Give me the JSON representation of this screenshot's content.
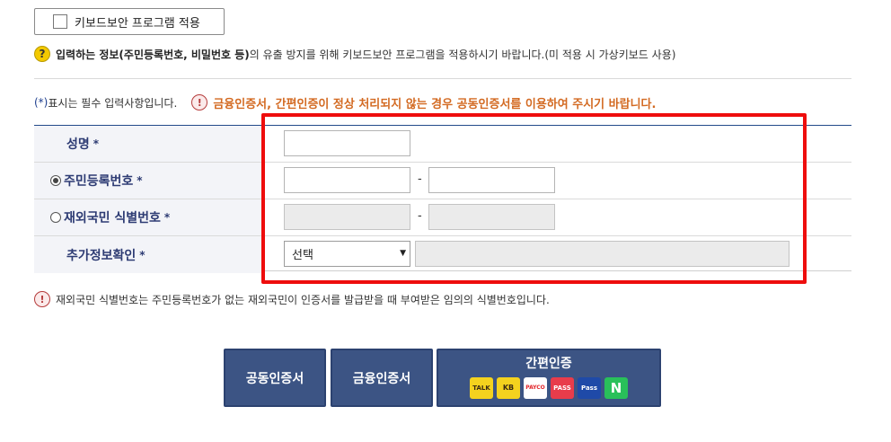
{
  "keyboard_security": {
    "label": "키보드보안 프로그램 적용",
    "checked": false
  },
  "notice": {
    "icon": "?",
    "bold_text": "입력하는 정보(주민등록번호, 비밀번호 등)",
    "rest_text": "의 유출 방지를 위해 키보드보안 프로그램을 적용하시기 바랍니다.(미 적용 시 가상키보드 사용)"
  },
  "required_note": {
    "star": "(*)",
    "text": " 표시는 필수 입력사항입니다."
  },
  "warning": {
    "icon": "!",
    "text": "금융인증서, 간편인증이 정상 처리되지 않는 경우 공동인증서를 이용하여 주시기 바랍니다."
  },
  "form": {
    "name": {
      "label": "성명",
      "star": "*",
      "value": ""
    },
    "resident": {
      "label": "주민등록번호",
      "star": "*",
      "selected": true,
      "dash": "-",
      "front": "",
      "back": ""
    },
    "foreign": {
      "label": "재외국민 식별번호",
      "star": "*",
      "selected": false,
      "dash": "-",
      "front": "",
      "back": ""
    },
    "extra": {
      "label": "추가정보확인",
      "star": "*",
      "select_value": "선택",
      "select_arrow": "▼",
      "value": ""
    }
  },
  "footnote": {
    "icon": "!",
    "text": "재외국민 식별번호는 주민등록번호가 없는 재외국민이 인증서를 발급받을 때 부여받은 임의의 식별번호입니다."
  },
  "buttons": {
    "joint_cert": "공동인증서",
    "financial_cert": "금융인증서",
    "simple_auth": "간편인증",
    "providers": [
      {
        "name": "kakao-icon",
        "label": "TALK"
      },
      {
        "name": "kb-icon",
        "label": "KB"
      },
      {
        "name": "payco-icon",
        "label": "PAYCO"
      },
      {
        "name": "pass-icon",
        "label": "PASS"
      },
      {
        "name": "samsung-pass-icon",
        "label": "Pass"
      },
      {
        "name": "naver-icon",
        "label": "N"
      }
    ]
  },
  "colors": {
    "highlight": "#ee0d0d",
    "button": "#3c5484",
    "label_text": "#2d3b73",
    "warning_text": "#d36a22"
  }
}
